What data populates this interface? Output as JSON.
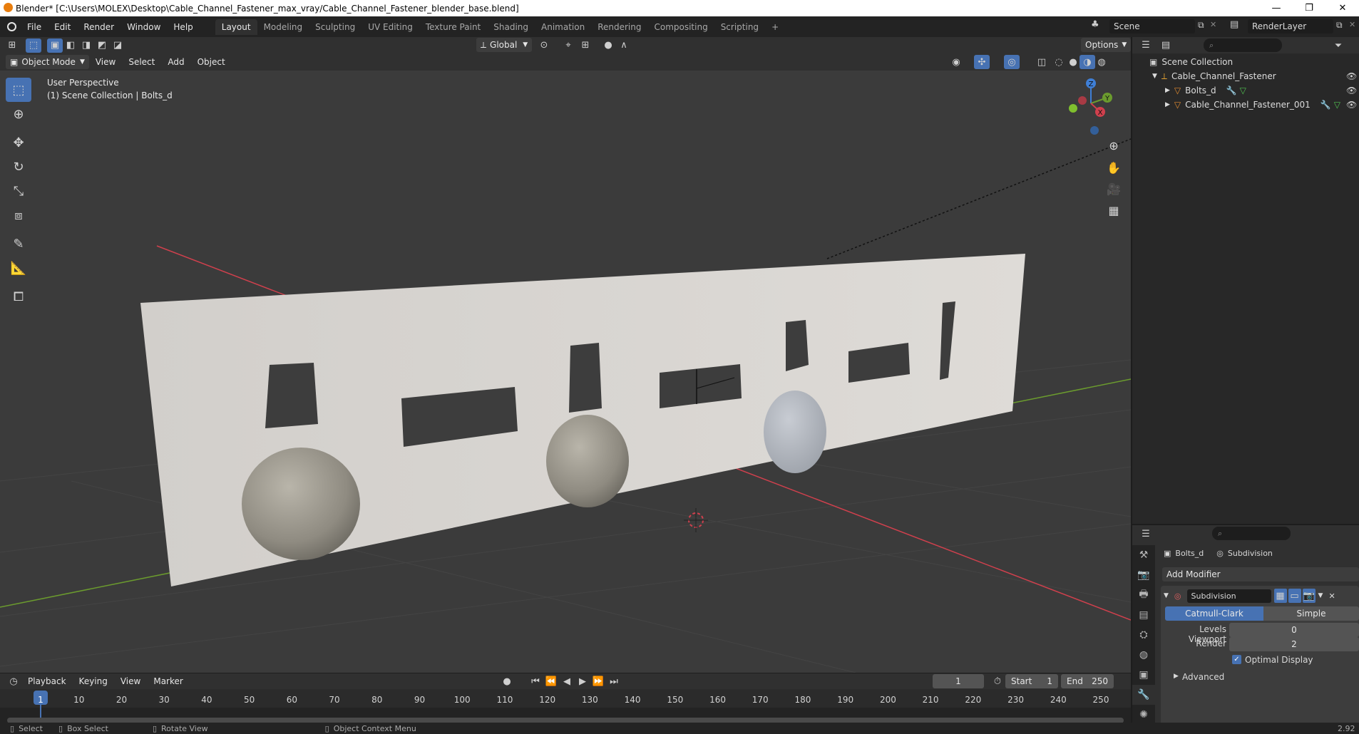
{
  "window": {
    "title": "Blender* [C:\\Users\\MOLEX\\Desktop\\Cable_Channel_Fastener_max_vray/Cable_Channel_Fastener_blender_base.blend]",
    "controls": {
      "minimize": "—",
      "maximize": "❐",
      "close": "✕"
    }
  },
  "menubar": {
    "menus": [
      "File",
      "Edit",
      "Render",
      "Window",
      "Help"
    ],
    "workspaces": [
      "Layout",
      "Modeling",
      "Sculpting",
      "UV Editing",
      "Texture Paint",
      "Shading",
      "Animation",
      "Rendering",
      "Compositing",
      "Scripting"
    ],
    "active_workspace": "Layout",
    "add_tab": "+",
    "scene": "Scene",
    "view_layer": "RenderLayer"
  },
  "viewport_header": {
    "orientation": "Global",
    "options": "Options",
    "mode": "Object Mode",
    "menus": [
      "View",
      "Select",
      "Add",
      "Object"
    ]
  },
  "viewport": {
    "perspective": "User Perspective",
    "collection_info": "(1) Scene Collection | Bolts_d",
    "gizmo_axes": {
      "z": "Z",
      "y": "Y",
      "x": "X"
    }
  },
  "outliner": {
    "root": "Scene Collection",
    "collection": "Cable_Channel_Fastener",
    "objects": [
      "Bolts_d",
      "Cable_Channel_Fastener_001"
    ]
  },
  "properties": {
    "object": "Bolts_d",
    "modifier_context": "Subdivision",
    "add_modifier": "Add Modifier",
    "modifier_name": "Subdivision",
    "algorithm_options": [
      "Catmull-Clark",
      "Simple"
    ],
    "active_algorithm": "Catmull-Clark",
    "levels_viewport_label": "Levels Viewport",
    "levels_viewport_value": "0",
    "render_label": "Render",
    "render_value": "2",
    "optimal_display_label": "Optimal Display",
    "optimal_display_checked": true,
    "advanced_label": "Advanced"
  },
  "timeline": {
    "menus": [
      "Playback",
      "Keying",
      "View",
      "Marker"
    ],
    "current_frame": "1",
    "start_label": "Start",
    "start_value": "1",
    "end_label": "End",
    "end_value": "250",
    "ticks": [
      "1",
      "10",
      "20",
      "30",
      "40",
      "50",
      "60",
      "70",
      "80",
      "90",
      "100",
      "110",
      "120",
      "130",
      "140",
      "150",
      "160",
      "170",
      "180",
      "190",
      "200",
      "210",
      "220",
      "230",
      "240",
      "250"
    ]
  },
  "statusbar": {
    "items": [
      "Select",
      "Box Select",
      "Rotate View",
      "Object Context Menu"
    ],
    "version": "2.92"
  },
  "colors": {
    "accent": "#4772b3",
    "axis_x": "#d0404d",
    "axis_y": "#6b9b2e",
    "axis_z": "#3f7fd6"
  }
}
